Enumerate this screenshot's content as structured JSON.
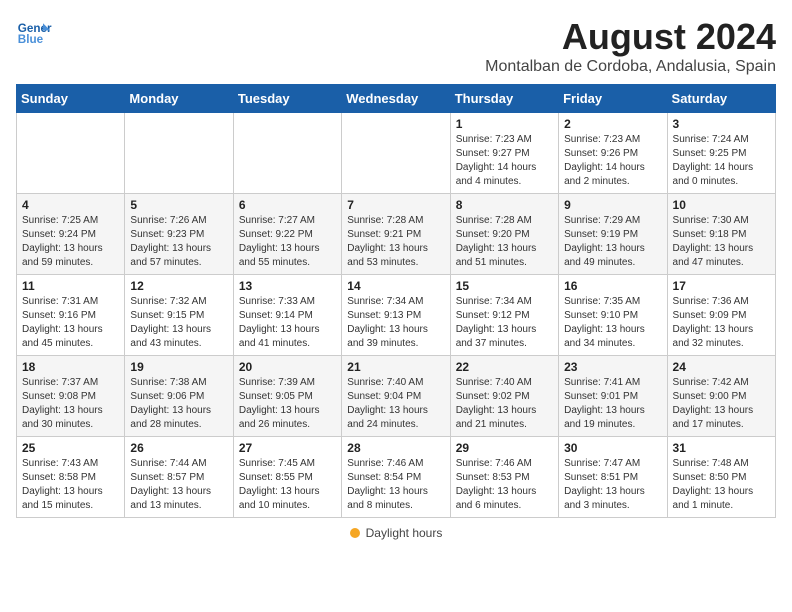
{
  "header": {
    "logo_text_general": "General",
    "logo_text_blue": "Blue",
    "main_title": "August 2024",
    "subtitle": "Montalban de Cordoba, Andalusia, Spain"
  },
  "calendar": {
    "days_of_week": [
      "Sunday",
      "Monday",
      "Tuesday",
      "Wednesday",
      "Thursday",
      "Friday",
      "Saturday"
    ],
    "weeks": [
      [
        {
          "day": "",
          "info": ""
        },
        {
          "day": "",
          "info": ""
        },
        {
          "day": "",
          "info": ""
        },
        {
          "day": "",
          "info": ""
        },
        {
          "day": "1",
          "info": "Sunrise: 7:23 AM\nSunset: 9:27 PM\nDaylight: 14 hours and 4 minutes."
        },
        {
          "day": "2",
          "info": "Sunrise: 7:23 AM\nSunset: 9:26 PM\nDaylight: 14 hours and 2 minutes."
        },
        {
          "day": "3",
          "info": "Sunrise: 7:24 AM\nSunset: 9:25 PM\nDaylight: 14 hours and 0 minutes."
        }
      ],
      [
        {
          "day": "4",
          "info": "Sunrise: 7:25 AM\nSunset: 9:24 PM\nDaylight: 13 hours and 59 minutes."
        },
        {
          "day": "5",
          "info": "Sunrise: 7:26 AM\nSunset: 9:23 PM\nDaylight: 13 hours and 57 minutes."
        },
        {
          "day": "6",
          "info": "Sunrise: 7:27 AM\nSunset: 9:22 PM\nDaylight: 13 hours and 55 minutes."
        },
        {
          "day": "7",
          "info": "Sunrise: 7:28 AM\nSunset: 9:21 PM\nDaylight: 13 hours and 53 minutes."
        },
        {
          "day": "8",
          "info": "Sunrise: 7:28 AM\nSunset: 9:20 PM\nDaylight: 13 hours and 51 minutes."
        },
        {
          "day": "9",
          "info": "Sunrise: 7:29 AM\nSunset: 9:19 PM\nDaylight: 13 hours and 49 minutes."
        },
        {
          "day": "10",
          "info": "Sunrise: 7:30 AM\nSunset: 9:18 PM\nDaylight: 13 hours and 47 minutes."
        }
      ],
      [
        {
          "day": "11",
          "info": "Sunrise: 7:31 AM\nSunset: 9:16 PM\nDaylight: 13 hours and 45 minutes."
        },
        {
          "day": "12",
          "info": "Sunrise: 7:32 AM\nSunset: 9:15 PM\nDaylight: 13 hours and 43 minutes."
        },
        {
          "day": "13",
          "info": "Sunrise: 7:33 AM\nSunset: 9:14 PM\nDaylight: 13 hours and 41 minutes."
        },
        {
          "day": "14",
          "info": "Sunrise: 7:34 AM\nSunset: 9:13 PM\nDaylight: 13 hours and 39 minutes."
        },
        {
          "day": "15",
          "info": "Sunrise: 7:34 AM\nSunset: 9:12 PM\nDaylight: 13 hours and 37 minutes."
        },
        {
          "day": "16",
          "info": "Sunrise: 7:35 AM\nSunset: 9:10 PM\nDaylight: 13 hours and 34 minutes."
        },
        {
          "day": "17",
          "info": "Sunrise: 7:36 AM\nSunset: 9:09 PM\nDaylight: 13 hours and 32 minutes."
        }
      ],
      [
        {
          "day": "18",
          "info": "Sunrise: 7:37 AM\nSunset: 9:08 PM\nDaylight: 13 hours and 30 minutes."
        },
        {
          "day": "19",
          "info": "Sunrise: 7:38 AM\nSunset: 9:06 PM\nDaylight: 13 hours and 28 minutes."
        },
        {
          "day": "20",
          "info": "Sunrise: 7:39 AM\nSunset: 9:05 PM\nDaylight: 13 hours and 26 minutes."
        },
        {
          "day": "21",
          "info": "Sunrise: 7:40 AM\nSunset: 9:04 PM\nDaylight: 13 hours and 24 minutes."
        },
        {
          "day": "22",
          "info": "Sunrise: 7:40 AM\nSunset: 9:02 PM\nDaylight: 13 hours and 21 minutes."
        },
        {
          "day": "23",
          "info": "Sunrise: 7:41 AM\nSunset: 9:01 PM\nDaylight: 13 hours and 19 minutes."
        },
        {
          "day": "24",
          "info": "Sunrise: 7:42 AM\nSunset: 9:00 PM\nDaylight: 13 hours and 17 minutes."
        }
      ],
      [
        {
          "day": "25",
          "info": "Sunrise: 7:43 AM\nSunset: 8:58 PM\nDaylight: 13 hours and 15 minutes."
        },
        {
          "day": "26",
          "info": "Sunrise: 7:44 AM\nSunset: 8:57 PM\nDaylight: 13 hours and 13 minutes."
        },
        {
          "day": "27",
          "info": "Sunrise: 7:45 AM\nSunset: 8:55 PM\nDaylight: 13 hours and 10 minutes."
        },
        {
          "day": "28",
          "info": "Sunrise: 7:46 AM\nSunset: 8:54 PM\nDaylight: 13 hours and 8 minutes."
        },
        {
          "day": "29",
          "info": "Sunrise: 7:46 AM\nSunset: 8:53 PM\nDaylight: 13 hours and 6 minutes."
        },
        {
          "day": "30",
          "info": "Sunrise: 7:47 AM\nSunset: 8:51 PM\nDaylight: 13 hours and 3 minutes."
        },
        {
          "day": "31",
          "info": "Sunrise: 7:48 AM\nSunset: 8:50 PM\nDaylight: 13 hours and 1 minute."
        }
      ]
    ]
  },
  "legend": {
    "daylight_label": "Daylight hours"
  }
}
